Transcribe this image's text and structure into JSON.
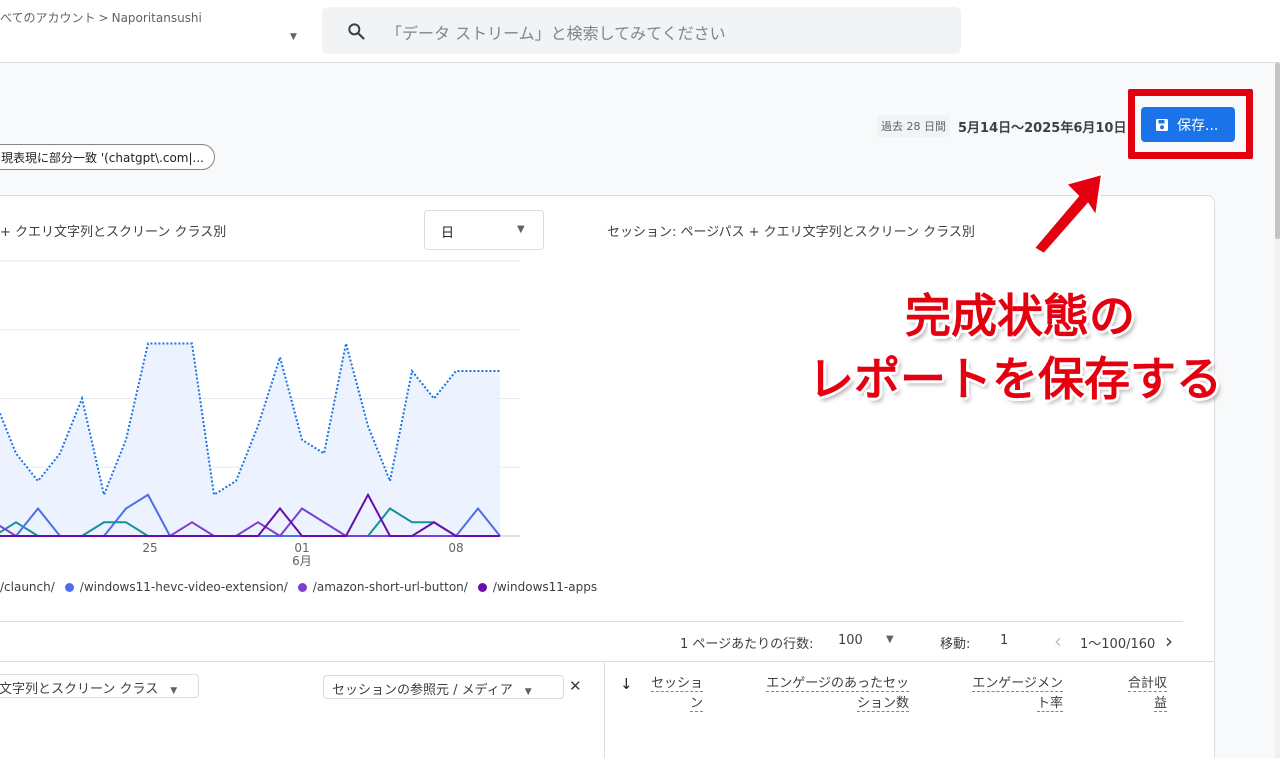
{
  "header": {
    "breadcrumb_all": "べてのアカウント",
    "breadcrumb_account": "Naporitansushi",
    "search_placeholder": "「データ ストリーム」と検索してみてください"
  },
  "toolbar": {
    "period_chip": "過去 28 日間",
    "date_range": "5月14日〜2025年6月10日",
    "save_label": "保存..."
  },
  "filter": {
    "chip_text": "現表現に部分一致 '(chatgpt\\.com|..."
  },
  "chart_panel": {
    "left_title": "+ クエリ文字列とスクリーン クラス別",
    "granularity": "日",
    "right_title": "セッション: ページパス + クエリ文字列とスクリーン クラス別"
  },
  "chart_data": {
    "type": "line",
    "x_ticks": [
      {
        "label": "25",
        "sub": ""
      },
      {
        "label": "01",
        "sub": "6月"
      },
      {
        "label": "08",
        "sub": ""
      }
    ],
    "x": [
      18,
      19,
      20,
      21,
      22,
      23,
      24,
      25,
      26,
      27,
      28,
      29,
      30,
      31,
      1,
      2,
      3,
      4,
      5,
      6,
      7,
      8,
      9,
      10
    ],
    "series": [
      {
        "name": "",
        "color": "#1a73e8",
        "dashed": true,
        "values": [
          10,
          6,
          4,
          6,
          10,
          3,
          7,
          14,
          14,
          14,
          3,
          4,
          8,
          13,
          7,
          6,
          14,
          8,
          4,
          12,
          10,
          12,
          12,
          12
        ]
      },
      {
        "name": "/claunch/",
        "color": "#12939a",
        "dashed": false,
        "values": [
          0,
          1,
          0,
          0,
          0,
          1,
          1,
          0,
          0,
          0,
          0,
          0,
          0,
          0,
          0,
          0,
          0,
          0,
          2,
          1,
          1,
          0,
          0,
          0
        ]
      },
      {
        "name": "/windows11-hevc-video-extension/",
        "color": "#4c6ee6",
        "dashed": false,
        "values": [
          0,
          0,
          2,
          0,
          0,
          0,
          2,
          3,
          0,
          0,
          0,
          0,
          0,
          0,
          0,
          0,
          0,
          0,
          0,
          0,
          0,
          0,
          2,
          0
        ]
      },
      {
        "name": "/amazon-short-url-button/",
        "color": "#7b3fd1",
        "dashed": false,
        "values": [
          1,
          0,
          0,
          0,
          0,
          0,
          0,
          0,
          0,
          1,
          0,
          0,
          1,
          0,
          2,
          1,
          0,
          0,
          0,
          0,
          0,
          0,
          0,
          0
        ]
      },
      {
        "name": "/windows11-apps",
        "color": "#6a0dad",
        "dashed": false,
        "values": [
          0,
          0,
          0,
          0,
          0,
          0,
          0,
          0,
          0,
          0,
          0,
          0,
          0,
          2,
          0,
          0,
          0,
          3,
          0,
          0,
          1,
          0,
          0,
          0
        ]
      }
    ],
    "ylim": [
      0,
      20
    ]
  },
  "legend": [
    {
      "label": "/claunch/",
      "color": "#12939a"
    },
    {
      "label": "/windows11-hevc-video-extension/",
      "color": "#4c6ee6"
    },
    {
      "label": "/amazon-short-url-button/",
      "color": "#7b3fd1"
    },
    {
      "label": "/windows11-apps",
      "color": "#6a0dad"
    }
  ],
  "pager": {
    "rows_label": "1 ページあたりの行数:",
    "rows_value": "100",
    "goto_label": "移動:",
    "goto_value": "1",
    "range": "1〜100/160"
  },
  "table": {
    "dim1": "文字列とスクリーン クラス",
    "dim2": "セッションの参照元 / メディア",
    "col_sessions_1": "セッショ",
    "col_sessions_2": "ン",
    "col_engaged_1": "エンゲージのあったセッ",
    "col_engaged_2": "ション数",
    "col_rate_1": "エンゲージメン",
    "col_rate_2": "ト率",
    "col_revenue_1": "合計収",
    "col_revenue_2": "益"
  },
  "annotation": {
    "line1": "完成状態の",
    "line2": "レポートを保存する",
    "color": "#e5000f"
  }
}
